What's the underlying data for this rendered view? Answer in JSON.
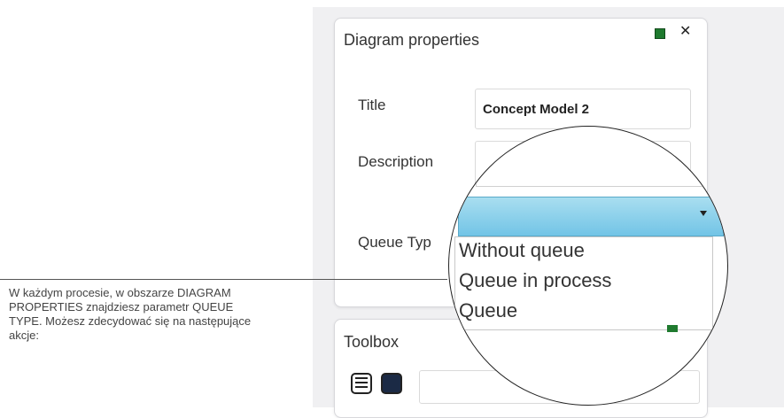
{
  "diagram_properties": {
    "title": "Diagram properties",
    "fields": {
      "title_label": "Title",
      "title_value": "Concept Model 2",
      "description_label": "Description",
      "queue_type_label": "Queue Typ"
    }
  },
  "queue_type_dropdown": {
    "options": [
      "Without queue",
      "Queue in process",
      "Queue"
    ]
  },
  "toolbox": {
    "title": "Toolbox"
  },
  "callout": {
    "text": "W każdym procesie, w obszarze DIAGRAM PROPERTIES znajdziesz parametr QUEUE TYPE. Możesz zdecydować się na następujące akcje:"
  },
  "colors": {
    "select_highlight": "#72c4e6",
    "pin_green": "#1f7a2f",
    "background_gray": "#f0f0f2"
  },
  "icons": {
    "pin": "pin-icon",
    "close": "close-icon",
    "dropdown_arrow": "chevron-down-icon",
    "list_view": "list-view-icon",
    "block_view": "block-view-icon"
  }
}
